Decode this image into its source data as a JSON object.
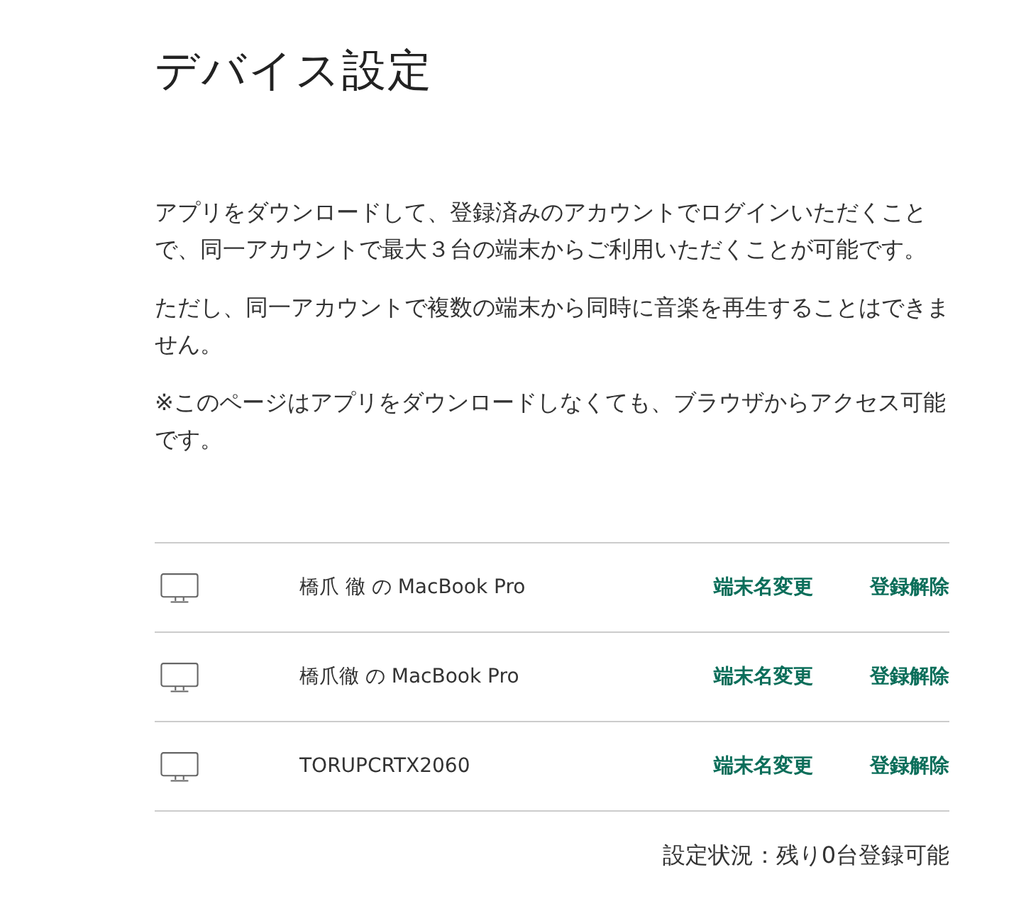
{
  "page": {
    "title": "デバイス設定"
  },
  "paragraphs": [
    "アプリをダウンロードして、登録済みのアカウントでログインいただくことで、同一アカウントで最大３台の端末からご利用いただくことが可能です。",
    "ただし、同一アカウントで複数の端末から同時に音楽を再生することはできません。",
    "※このページはアプリをダウンロードしなくても、ブラウザからアクセス可能です。"
  ],
  "devices": [
    {
      "name": "橋爪 徹 の MacBook Pro",
      "actions": [
        "端末名変更",
        "登録解除"
      ]
    },
    {
      "name": "橋爪徹 の MacBook Pro",
      "actions": [
        "端末名変更",
        "登録解除"
      ]
    },
    {
      "name": "TORUPCRTX2060",
      "actions": [
        "端末名変更",
        "登録解除"
      ]
    }
  ],
  "status": "設定状況：残り0台登録可能"
}
